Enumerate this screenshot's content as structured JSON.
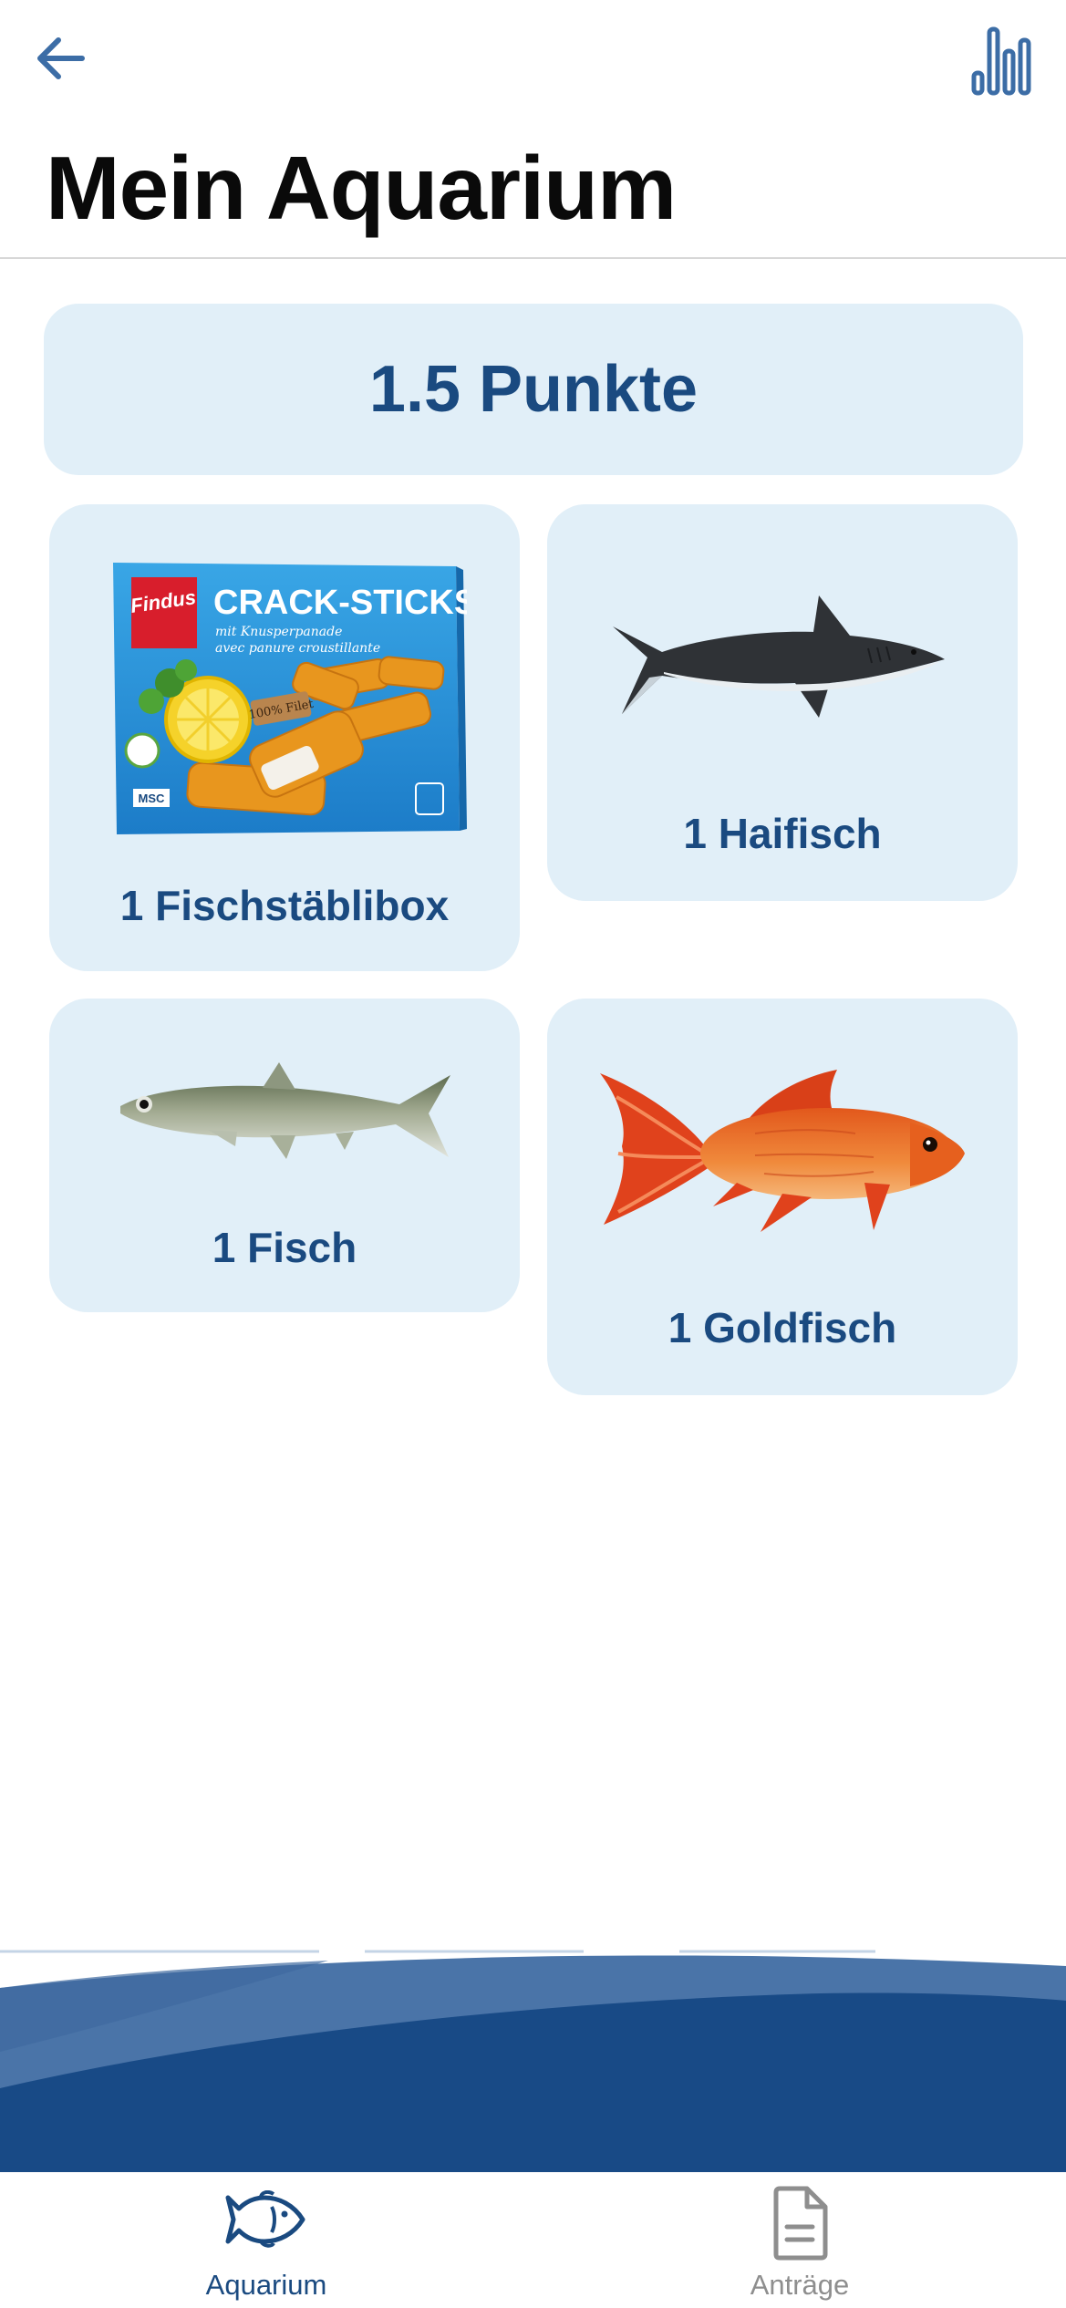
{
  "header": {
    "title": "Mein Aquarium",
    "back_icon": "arrow-left-icon",
    "stats_icon": "bar-chart-icon"
  },
  "points": {
    "label": "1.5 Punkte"
  },
  "items": [
    {
      "label": "1 Fischstäblibox",
      "image": "fish-sticks-box-image",
      "box": {
        "brand": "Findus",
        "name": "CRACK-STICKS",
        "tagline_1": "mit Knusperpanade",
        "tagline_2": "avec panure croustillante",
        "badge": "100% Filet",
        "msc": "MSC"
      }
    },
    {
      "label": "1 Haifisch",
      "image": "shark-image"
    },
    {
      "label": "1 Fisch",
      "image": "fish-image"
    },
    {
      "label": "1 Goldfisch",
      "image": "goldfish-image"
    }
  ],
  "tabs": [
    {
      "label": "Aquarium",
      "icon": "fish-icon",
      "active": true
    },
    {
      "label": "Anträge",
      "icon": "document-icon",
      "active": false
    }
  ],
  "colors": {
    "accent": "#1a4a80",
    "card_bg": "#e1eff8",
    "wave_dark": "#184a86",
    "wave_light": "#4a74a8",
    "inactive": "#8e8e8e"
  }
}
